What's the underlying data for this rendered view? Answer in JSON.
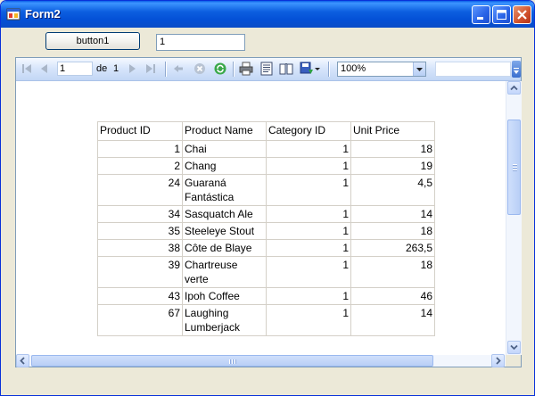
{
  "window": {
    "title": "Form2"
  },
  "form": {
    "button1_label": "button1",
    "textbox1_value": "1"
  },
  "toolbar": {
    "current_page": "1",
    "of_label": "de",
    "total_pages": "1",
    "zoom": "100%",
    "find_value": "",
    "icons": [
      "first-page-icon",
      "previous-page-icon",
      "next-page-icon",
      "last-page-icon",
      "back-icon",
      "stop-icon",
      "refresh-icon",
      "print-icon",
      "print-layout-icon",
      "page-setup-icon",
      "export-icon",
      "dropdown-arrow-icon"
    ]
  },
  "report": {
    "columns": [
      "Product ID",
      "Product Name",
      "Category ID",
      "Unit Price"
    ],
    "rows": [
      [
        "1",
        "Chai",
        "1",
        "18"
      ],
      [
        "2",
        "Chang",
        "1",
        "19"
      ],
      [
        "24",
        "Guaraná\nFantástica",
        "1",
        "4,5"
      ],
      [
        "34",
        "Sasquatch Ale",
        "1",
        "14"
      ],
      [
        "35",
        "Steeleye Stout",
        "1",
        "18"
      ],
      [
        "38",
        "Côte de Blaye",
        "1",
        "263,5"
      ],
      [
        "39",
        "Chartreuse\nverte",
        "1",
        "18"
      ],
      [
        "43",
        "Ipoh Coffee",
        "1",
        "46"
      ],
      [
        "67",
        "Laughing\nLumberjack",
        "1",
        "14"
      ]
    ]
  },
  "colors": {
    "titlebar": "#0a4cc7",
    "close_button": "#d0502a",
    "toolbar": "#d8e6fb",
    "grid_border": "#d4d0c8"
  }
}
